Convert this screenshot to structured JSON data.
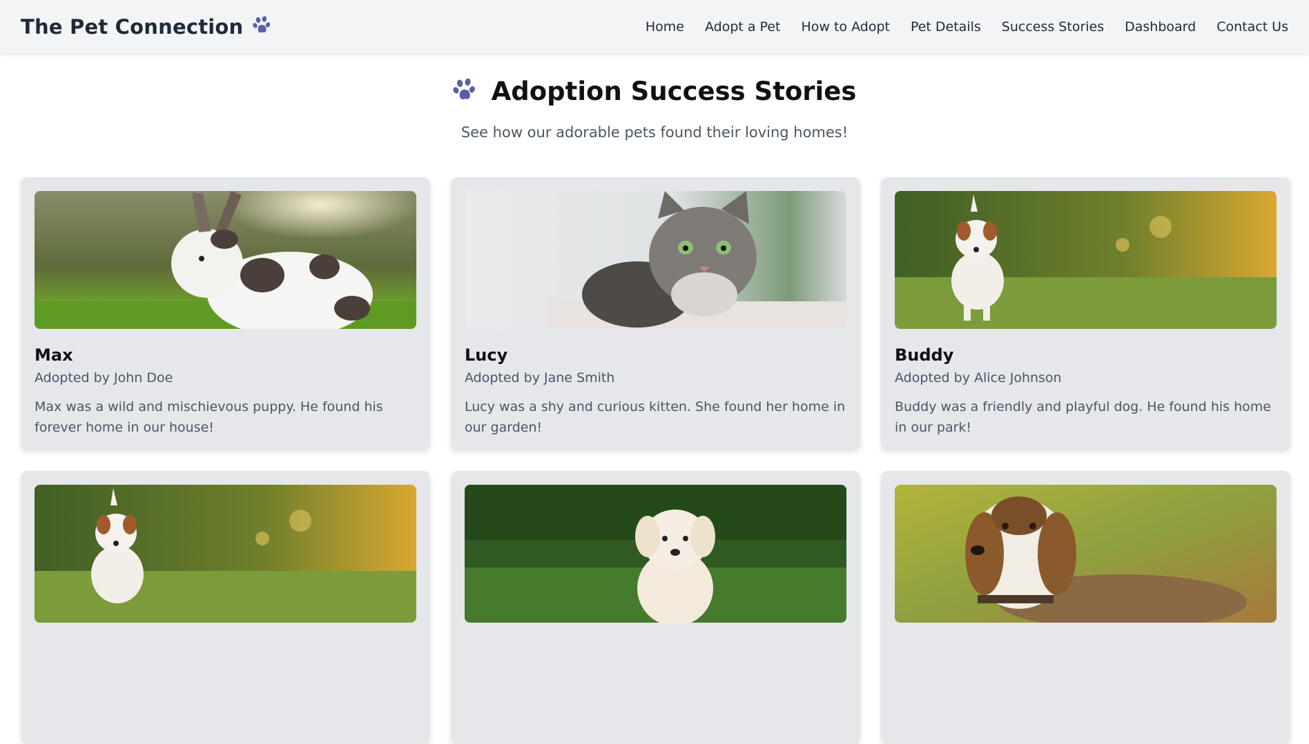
{
  "navbar": {
    "brand": "The Pet Connection",
    "brand_icon": "paw-icon",
    "links": [
      "Home",
      "Adopt a Pet",
      "How to Adopt",
      "Pet Details",
      "Success Stories",
      "Dashboard",
      "Contact Us"
    ]
  },
  "hero": {
    "icon": "paw-icon",
    "title": "Adoption Success Stories",
    "subtitle": "See how our adorable pets found their loving homes!"
  },
  "colors": {
    "navbar_bg": "#f3f4f6",
    "card_bg": "#e5e7eb",
    "paw_color": "#5b5ea6"
  },
  "stories": [
    {
      "name": "Max",
      "adopter": "Adopted by John Doe",
      "story": "Max was a wild and mischievous puppy. He found his forever home in our house!",
      "image": "rabbit-photo"
    },
    {
      "name": "Lucy",
      "adopter": "Adopted by Jane Smith",
      "story": "Lucy was a shy and curious kitten. She found her home in our garden!",
      "image": "tabby-cat-photo"
    },
    {
      "name": "Buddy",
      "adopter": "Adopted by Alice Johnson",
      "story": "Buddy was a friendly and playful dog. He found his home in our park!",
      "image": "terrier-running-photo"
    },
    {
      "image": "terrier-running-photo"
    },
    {
      "image": "golden-puppy-photo"
    },
    {
      "image": "beagle-photo"
    }
  ]
}
